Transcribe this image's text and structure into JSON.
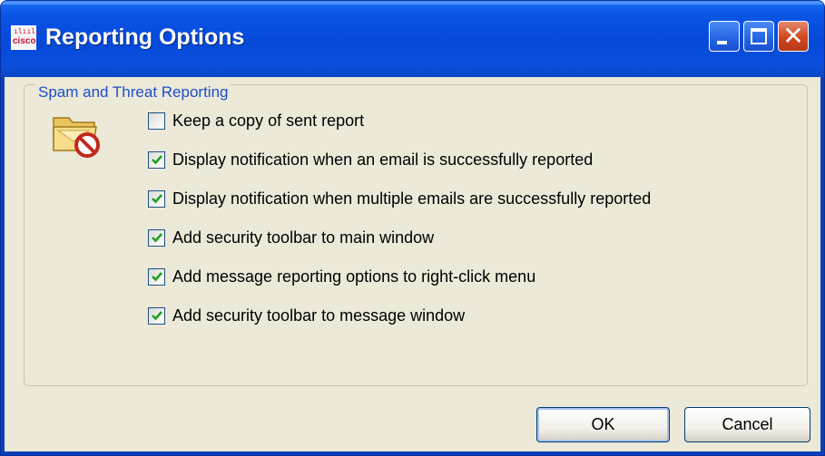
{
  "window": {
    "title": "Reporting Options",
    "logo_text": "cisco",
    "logo_dots": "ılıılı"
  },
  "titlebar_buttons": {
    "minimize": "minimize-icon",
    "maximize": "maximize-icon",
    "close": "close-icon",
    "close_glyph": "✕"
  },
  "group": {
    "title": "Spam and Threat Reporting",
    "icon": "folder-blocked-icon"
  },
  "options": [
    {
      "label": "Keep a copy of sent report",
      "checked": false
    },
    {
      "label": "Display notification when an email is successfully reported",
      "checked": true
    },
    {
      "label": "Display notification when multiple emails are successfully reported",
      "checked": true
    },
    {
      "label": "Add security toolbar to main window",
      "checked": true
    },
    {
      "label": "Add message reporting options to right-click menu",
      "checked": true
    },
    {
      "label": "Add security toolbar to message window",
      "checked": true
    }
  ],
  "buttons": {
    "ok": "OK",
    "cancel": "Cancel"
  },
  "colors": {
    "titlebar": "#0549d8",
    "group_title": "#1c4fc8",
    "client_bg": "#ece9d8",
    "checkmark": "#21a121",
    "close_button": "#d0461f"
  }
}
